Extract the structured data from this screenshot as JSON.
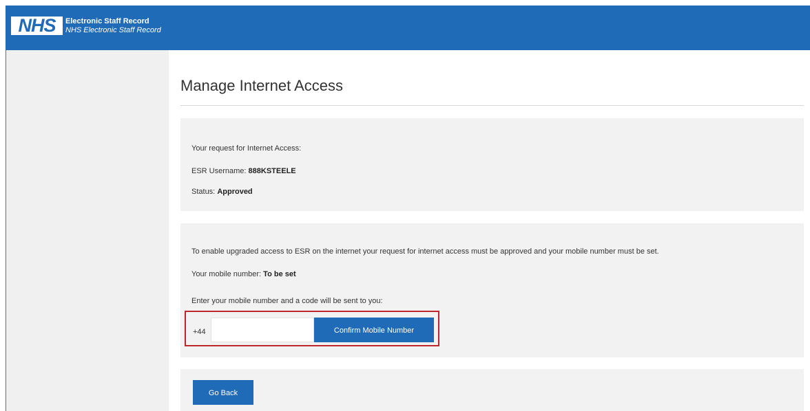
{
  "header": {
    "logo_text": "NHS",
    "brand_title": "Electronic Staff Record",
    "brand_subtitle": "NHS Electronic Staff Record",
    "colors": {
      "brand_blue": "#1f6bb8",
      "highlight_red": "#c0272d"
    }
  },
  "page": {
    "title": "Manage Internet Access"
  },
  "request": {
    "intro": "Your request for Internet Access:",
    "username_label": "ESR Username:",
    "username_value": "888KSTEELE",
    "status_label": "Status:",
    "status_value": "Approved"
  },
  "mobile": {
    "info": "To enable upgraded access to ESR on the internet your request for internet access must be approved and your mobile number must be set.",
    "number_label": "Your mobile number:",
    "number_value": "To be set",
    "instruction": "Enter your mobile number and a code will be sent to you:",
    "country_code": "+44",
    "input_value": "",
    "confirm_label": "Confirm Mobile Number"
  },
  "footer": {
    "back_label": "Go Back"
  }
}
